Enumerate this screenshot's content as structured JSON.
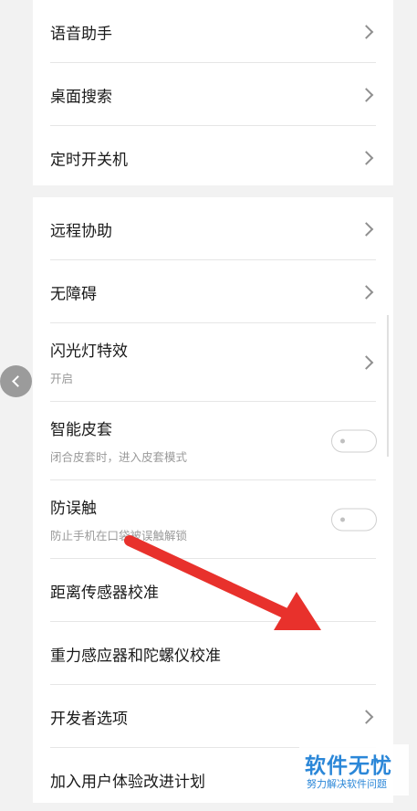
{
  "group1": {
    "items": [
      {
        "label": "语音助手"
      },
      {
        "label": "桌面搜索"
      },
      {
        "label": "定时开关机"
      }
    ]
  },
  "group2": {
    "items": [
      {
        "label": "远程协助"
      },
      {
        "label": "无障碍"
      },
      {
        "label": "闪光灯特效",
        "subtitle": "开启"
      },
      {
        "label": "智能皮套",
        "subtitle": "闭合皮套时，进入皮套模式",
        "toggle_on": false
      },
      {
        "label": "防误触",
        "subtitle": "防止手机在口袋被误触解锁",
        "toggle_on": false
      },
      {
        "label": "距离传感器校准"
      },
      {
        "label": "重力感应器和陀螺仪校准"
      },
      {
        "label": "开发者选项"
      },
      {
        "label": "加入用户体验改进计划"
      }
    ]
  },
  "annotation": {
    "arrow_color": "#e8312c"
  },
  "watermark": {
    "title": "软件无忧",
    "subtitle": "努力解决软件问题",
    "color": "#2b87d8"
  }
}
